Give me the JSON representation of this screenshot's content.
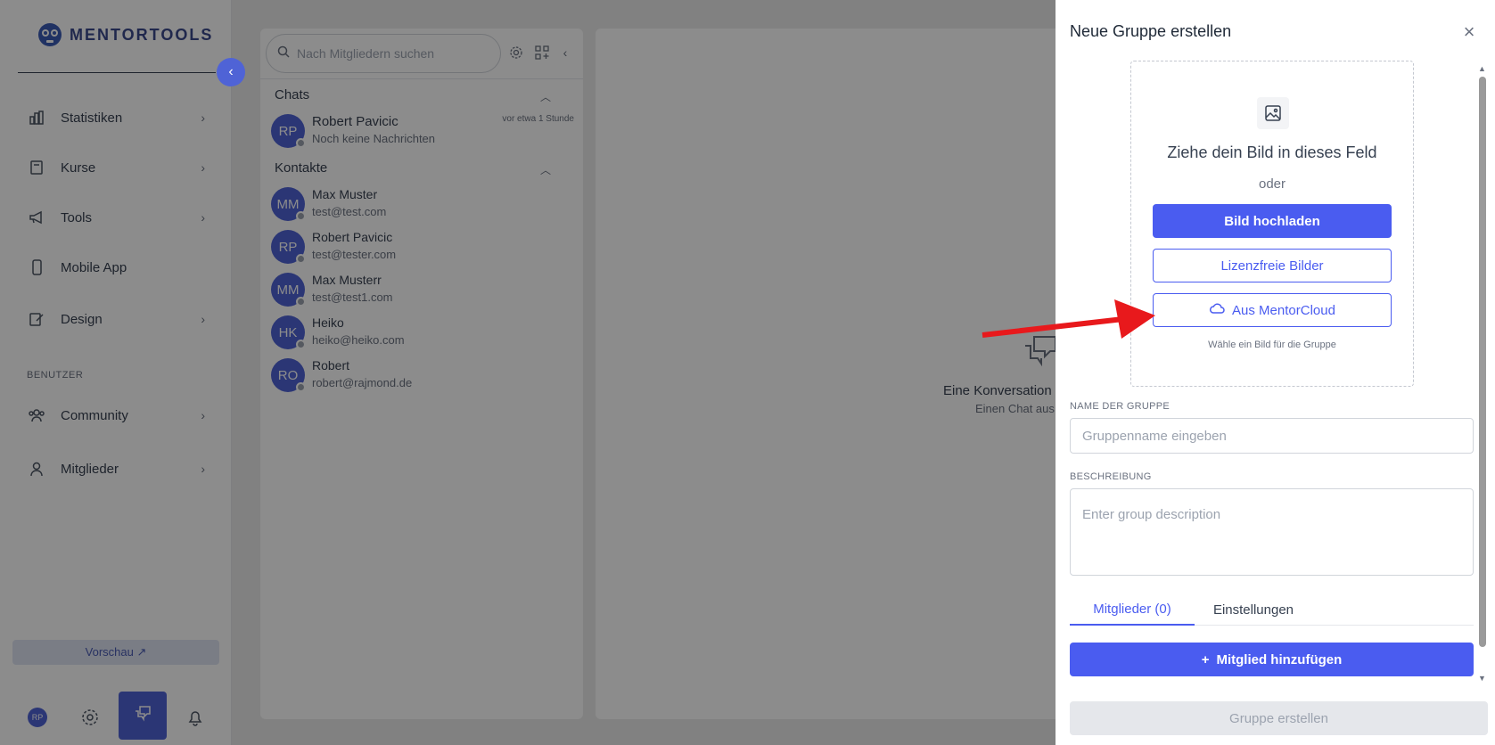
{
  "brand": {
    "name": "MENTORTOOLS"
  },
  "sidebar": {
    "items": [
      {
        "label": "Statistiken",
        "icon": "bar-chart-icon",
        "has_chevron": true
      },
      {
        "label": "Kurse",
        "icon": "book-icon",
        "has_chevron": true
      },
      {
        "label": "Tools",
        "icon": "megaphone-icon",
        "has_chevron": true
      },
      {
        "label": "Mobile App",
        "icon": "smartphone-icon",
        "has_chevron": false
      },
      {
        "label": "Design",
        "icon": "pencil-icon",
        "has_chevron": true
      }
    ],
    "section_label": "BENUTZER",
    "user_items": [
      {
        "label": "Community",
        "icon": "users-icon",
        "has_chevron": true
      },
      {
        "label": "Mitglieder",
        "icon": "user-icon",
        "has_chevron": true
      }
    ],
    "preview_label": "Vorschau ↗",
    "user_initials": "RP"
  },
  "chat_panel": {
    "search_placeholder": "Nach Mitgliedern suchen",
    "chats_header": "Chats",
    "chats": [
      {
        "initials": "RP",
        "name": "Robert Pavicic",
        "subtitle": "Noch keine Nachrichten",
        "time": "vor etwa 1 Stunde"
      }
    ],
    "contacts_header": "Kontakte",
    "contacts": [
      {
        "initials": "MM",
        "name": "Max Muster",
        "email": "test@test.com"
      },
      {
        "initials": "RP",
        "name": "Robert Pavicic",
        "email": "test@tester.com"
      },
      {
        "initials": "MM",
        "name": "Max Musterr",
        "email": "test@test1.com"
      },
      {
        "initials": "HK",
        "name": "Heiko",
        "email": "heiko@heiko.com"
      },
      {
        "initials": "RO",
        "name": "Robert",
        "email": "robert@rajmond.de"
      }
    ]
  },
  "conversation": {
    "empty_title": "Eine Konversation",
    "empty_subtitle": "Einen Chat aus"
  },
  "drawer": {
    "title": "Neue Gruppe erstellen",
    "dropzone": {
      "title": "Ziehe dein Bild in dieses Feld",
      "or": "oder",
      "upload_label": "Bild hochladen",
      "free_images_label": "Lizenzfreie Bilder",
      "mentorcloud_label": "Aus MentorCloud",
      "hint": "Wähle ein Bild für die Gruppe"
    },
    "name_label": "NAME DER GRUPPE",
    "name_placeholder": "Gruppenname eingeben",
    "name_value": "",
    "description_label": "BESCHREIBUNG",
    "description_placeholder": "Enter group description",
    "description_value": "",
    "tabs": [
      {
        "label": "Mitglieder (0)",
        "active": true
      },
      {
        "label": "Einstellungen",
        "active": false
      }
    ],
    "add_member_label": "Mitglied hinzufügen",
    "create_label": "Gruppe erstellen"
  },
  "colors": {
    "accent": "#4a5cf0",
    "annotation_arrow": "#e8191c"
  }
}
